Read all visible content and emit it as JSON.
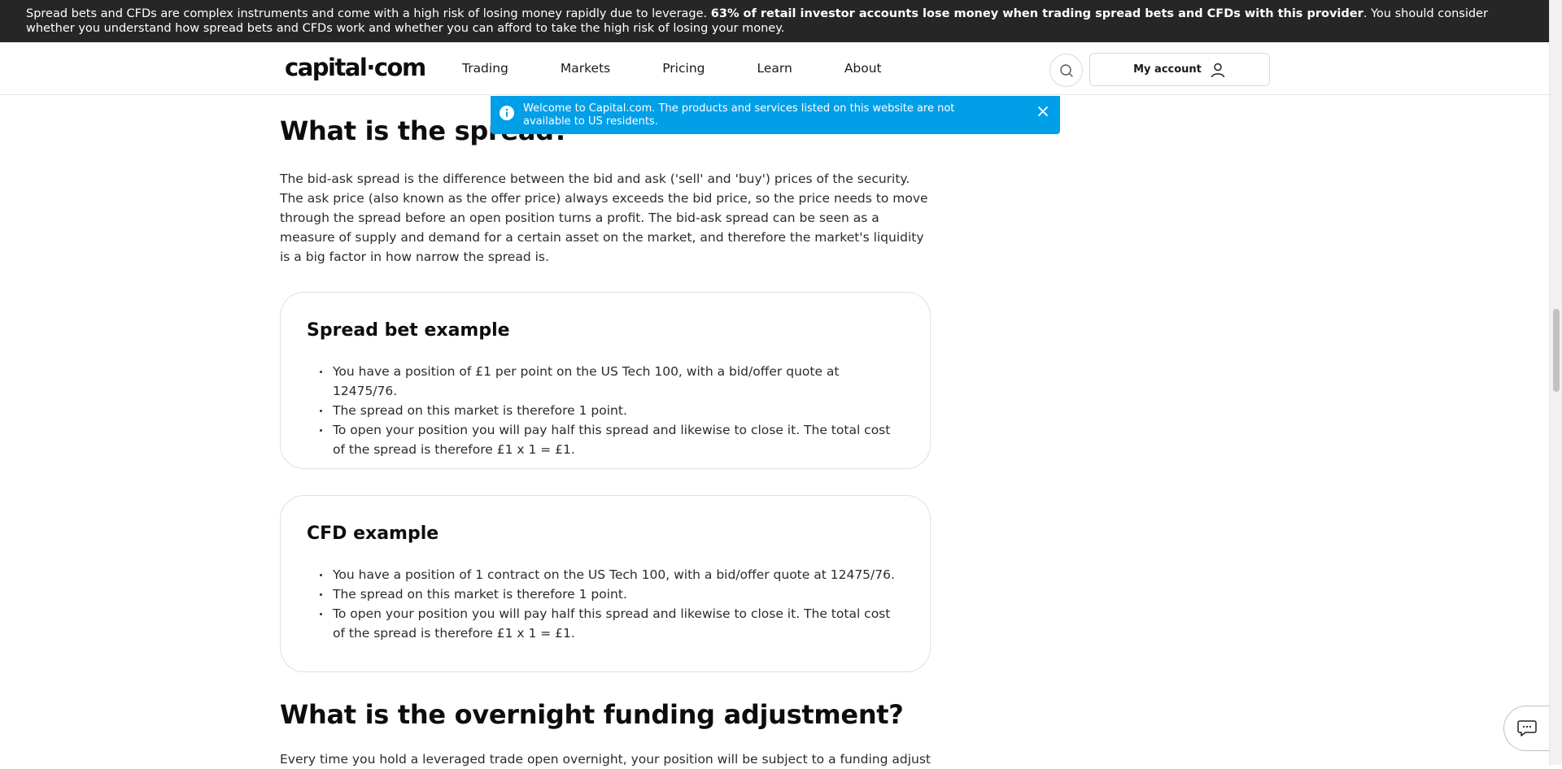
{
  "risk_banner": {
    "text_start": "Spread bets and CFDs are complex instruments and come with a high risk of losing money rapidly due to leverage. ",
    "text_bold": "63% of retail investor accounts lose money when trading spread bets and CFDs with this provider",
    "text_end": ". You should consider whether you understand how spread bets and CFDs work and whether you can afford to take the high risk of losing your money."
  },
  "header": {
    "logo": "capital·com",
    "nav": [
      "Trading",
      "Markets",
      "Pricing",
      "Learn",
      "About"
    ],
    "account_label": "My account"
  },
  "notice": {
    "text": "Welcome to Capital.com. The products and services listed on this website are not available to US residents."
  },
  "main": {
    "spread_heading": "What is the spread?",
    "spread_paragraph": "The bid-ask spread is the difference between the bid and ask ('sell' and 'buy') prices of the security. The ask price (also known as the offer price) always exceeds the bid price, so the price needs to move through the spread before an open position turns a profit. The bid-ask spread can be seen as a measure of supply and demand for a certain asset on the market, and therefore the market's liquidity is a big factor in how narrow the spread is.",
    "spread_bet_example": {
      "title": "Spread bet example",
      "items": [
        "You have a position of £1 per point on the US Tech 100, with a bid/offer quote at 12475/76.",
        "The spread on this market is therefore 1 point.",
        "To open your position you will pay half this spread and likewise to close it. The total cost of the spread is therefore £1 x 1 = £1."
      ]
    },
    "cfd_example": {
      "title": "CFD example",
      "items": [
        "You have a position of 1 contract on the US Tech 100, with a bid/offer quote at 12475/76.",
        "The spread on this market is therefore 1 point.",
        "To open your position you will pay half this spread and likewise to close it. The total cost of the spread is therefore £1 x 1 = £1."
      ]
    },
    "overnight_heading": "What is the overnight funding adjustment?",
    "overnight_paragraph": "Every time you hold a leveraged trade open overnight, your position will be subject to a funding adjustment."
  },
  "icons": {
    "search": "search-icon",
    "account": "user-icon",
    "info": "info-icon",
    "close": "close-icon",
    "chat": "chat-icon"
  },
  "colors": {
    "risk_banner_bg": "#262626",
    "notice_bg": "#009fe8",
    "text": "#1a1a1a"
  }
}
